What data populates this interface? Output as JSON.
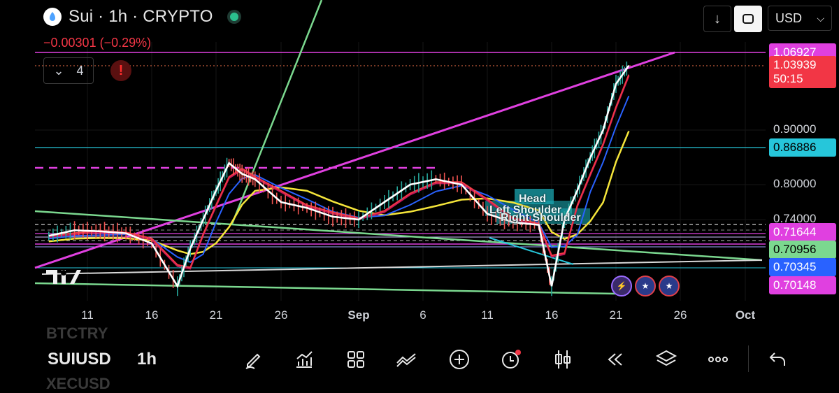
{
  "header": {
    "symbol_title": "Sui · 1h · CRYPTO",
    "change": "−0.00301 (−0.29%)",
    "indicator_count": "4",
    "warning": "!"
  },
  "toolbar": {
    "currency": "USD"
  },
  "bottom": {
    "ghost_top": "BTCTRY",
    "symbol": "SUIUSD",
    "interval": "1h",
    "ghost_bottom": "XECUSD"
  },
  "colors": {
    "magenta": "#e040e0",
    "cyan": "#26c6da",
    "green": "#7bd88f",
    "yellow": "#f5e53a",
    "red": "#f23645",
    "blue": "#2962ff",
    "white": "#ffffff"
  },
  "chart_data": {
    "type": "line",
    "x_ticks": [
      "11",
      "16",
      "21",
      "26",
      "Sep",
      "6",
      "11",
      "16",
      "21",
      "26",
      "Oct"
    ],
    "y_ticks": [
      0.9,
      0.8,
      0.74
    ],
    "y_tick_labels": [
      "0.90000",
      "0.80000",
      "0.74000"
    ],
    "price_labels": [
      {
        "text": "1.06927",
        "value": 1.06927,
        "color": "#e040e0"
      },
      {
        "text": "1.03939",
        "text2": "50:15",
        "value": 1.03939,
        "color": "#f23645"
      },
      {
        "text": "0.86886",
        "value": 0.86886,
        "color": "#26c6da"
      },
      {
        "text": "0.71644",
        "value": 0.71644,
        "color": "#e040e0"
      },
      {
        "text": "0.70956",
        "value": 0.70956,
        "color": "#7bd88f"
      },
      {
        "text": "0.70345",
        "value": 0.70345,
        "color": "#2962ff"
      },
      {
        "text": "0.70148",
        "value": 0.70148,
        "color": "#e040e0"
      }
    ],
    "annotations": [
      "Head",
      "Left Shoulder",
      "Right Shoulder"
    ],
    "price_series": {
      "name": "SUIUSD",
      "x": [
        "Aug 8",
        "Aug 10",
        "Aug 12",
        "Aug 14",
        "Aug 16",
        "Aug 18",
        "Aug 19",
        "Aug 20",
        "Aug 21",
        "Aug 22",
        "Aug 23",
        "Aug 24",
        "Aug 26",
        "Aug 28",
        "Aug 30",
        "Sep 1",
        "Sep 3",
        "Sep 5",
        "Sep 7",
        "Sep 9",
        "Sep 11",
        "Sep 13",
        "Sep 15",
        "Sep 16",
        "Sep 17",
        "Sep 18",
        "Sep 19",
        "Sep 20",
        "Sep 21",
        "Sep 22"
      ],
      "values": [
        0.715,
        0.72,
        0.718,
        0.716,
        0.712,
        0.7,
        0.71,
        0.74,
        0.79,
        0.84,
        0.82,
        0.81,
        0.77,
        0.76,
        0.745,
        0.74,
        0.77,
        0.8,
        0.81,
        0.8,
        0.75,
        0.735,
        0.73,
        0.7,
        0.74,
        0.79,
        0.85,
        0.9,
        1.0,
        1.04
      ]
    }
  }
}
